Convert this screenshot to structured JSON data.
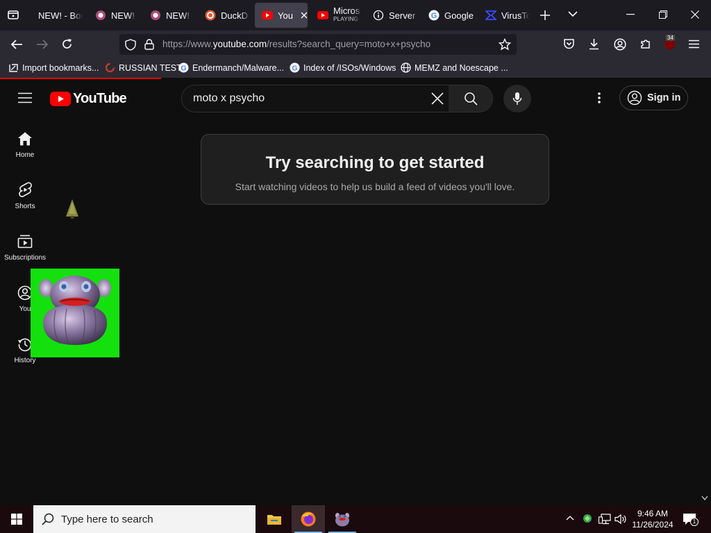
{
  "browser": {
    "tabs": [
      {
        "label": "NEW! - Bor",
        "icon": "sparkle-icon",
        "active": false
      },
      {
        "label": "NEW! -",
        "icon": "sparkle-icon",
        "active": false
      },
      {
        "label": "NEW! -",
        "icon": "sparkle-icon",
        "active": false
      },
      {
        "label": "DuckD",
        "icon": "duckduckgo-icon",
        "active": false
      },
      {
        "label": "You",
        "icon": "youtube-icon",
        "active": true
      },
      {
        "label": "Micros",
        "sublabel": "PLAYING",
        "icon": "youtube-icon",
        "active": false
      },
      {
        "label": "Server",
        "icon": "info-icon",
        "active": false
      },
      {
        "label": "Google",
        "icon": "google-icon",
        "active": false
      },
      {
        "label": "VirusTo",
        "icon": "virustotal-icon",
        "active": false
      }
    ],
    "url": {
      "scheme": "https://www.",
      "host": "youtube.com",
      "path": "/results?search_query=moto+x+psycho"
    },
    "extensions_badge": "34",
    "bookmarks": [
      {
        "label": "Import bookmarks...",
        "icon": "import-icon"
      },
      {
        "label": "RUSSIAN TEST",
        "icon": "site-icon"
      },
      {
        "label": "Endermanch/Malware...",
        "icon": "google-icon"
      },
      {
        "label": "Index of /ISOs/Windows",
        "icon": "google-icon"
      },
      {
        "label": "MEMZ and Noescape ...",
        "icon": "globe-icon"
      }
    ]
  },
  "youtube": {
    "logo_text": "YouTube",
    "search_query": "moto x psycho",
    "sign_in_label": "Sign in",
    "guide": [
      {
        "label": "Home",
        "icon": "home-icon"
      },
      {
        "label": "Shorts",
        "icon": "shorts-icon"
      },
      {
        "label": "Subscriptions",
        "icon": "subscriptions-icon"
      },
      {
        "label": "You",
        "icon": "you-icon"
      },
      {
        "label": "History",
        "icon": "history-icon"
      }
    ],
    "empty_state": {
      "title": "Try searching to get started",
      "subtitle": "Start watching videos to help us build a feed of videos you'll love."
    }
  },
  "taskbar": {
    "search_placeholder": "Type here to search",
    "time": "9:46 AM",
    "date": "11/26/2024",
    "notification_count": "1"
  },
  "colors": {
    "youtube_red": "#ff0000",
    "page_bg": "#0f0f0f",
    "overlay_green": "#14e00d",
    "tab_active": "#42414d"
  }
}
